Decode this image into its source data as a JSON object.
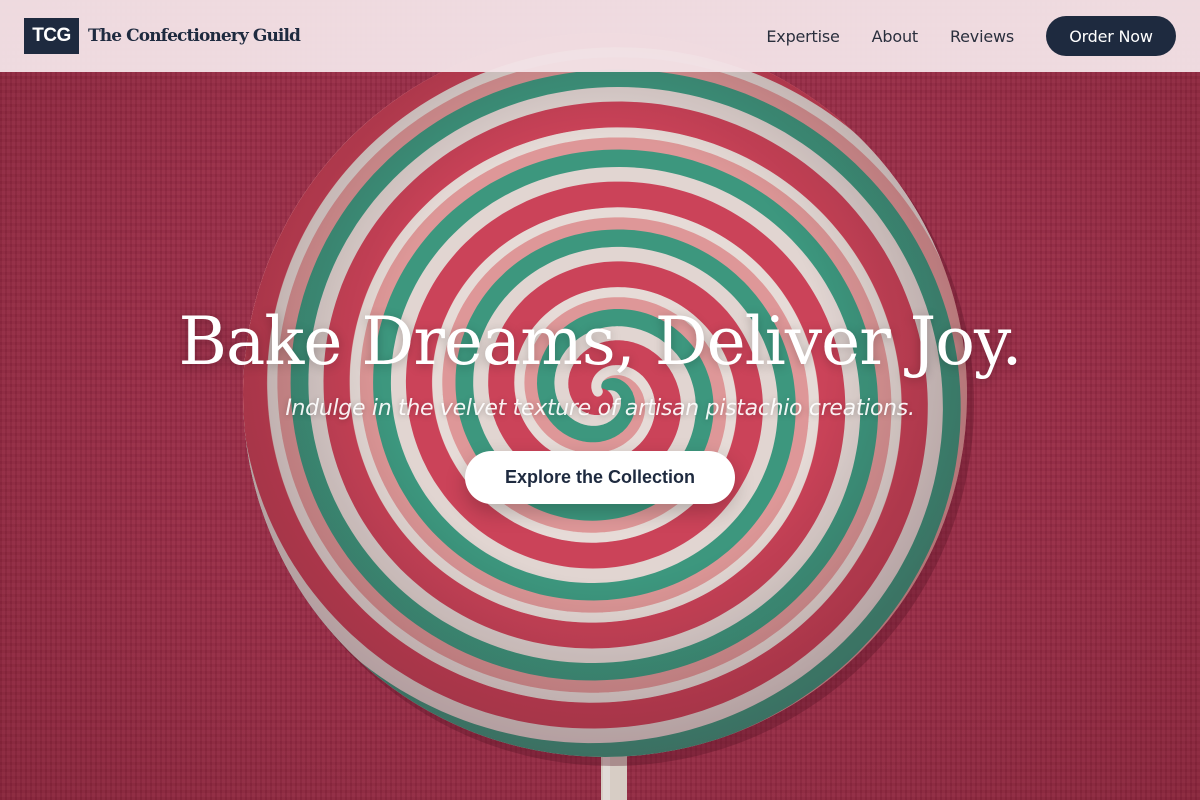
{
  "header": {
    "logo_text": "TCG",
    "brand_name": "The Confectionery Guild",
    "nav": [
      {
        "label": "Expertise"
      },
      {
        "label": "About"
      },
      {
        "label": "Reviews"
      }
    ],
    "order_label": "Order Now"
  },
  "hero": {
    "headline": "Bake Dreams, Deliver Joy.",
    "subheadline": "Indulge in the velvet texture of artisan pistachio creations.",
    "cta_label": "Explore the Collection",
    "image_subject": "swirl-lollipop-photo"
  },
  "colors": {
    "navy": "#1e2a3f",
    "header_bg": "#f2e2e6",
    "backdrop_red": "#a8324e",
    "candy_green": "#3ea88a",
    "candy_red": "#dc4a60",
    "candy_pink": "#f2a6a4",
    "candy_white": "#f4ece6"
  }
}
